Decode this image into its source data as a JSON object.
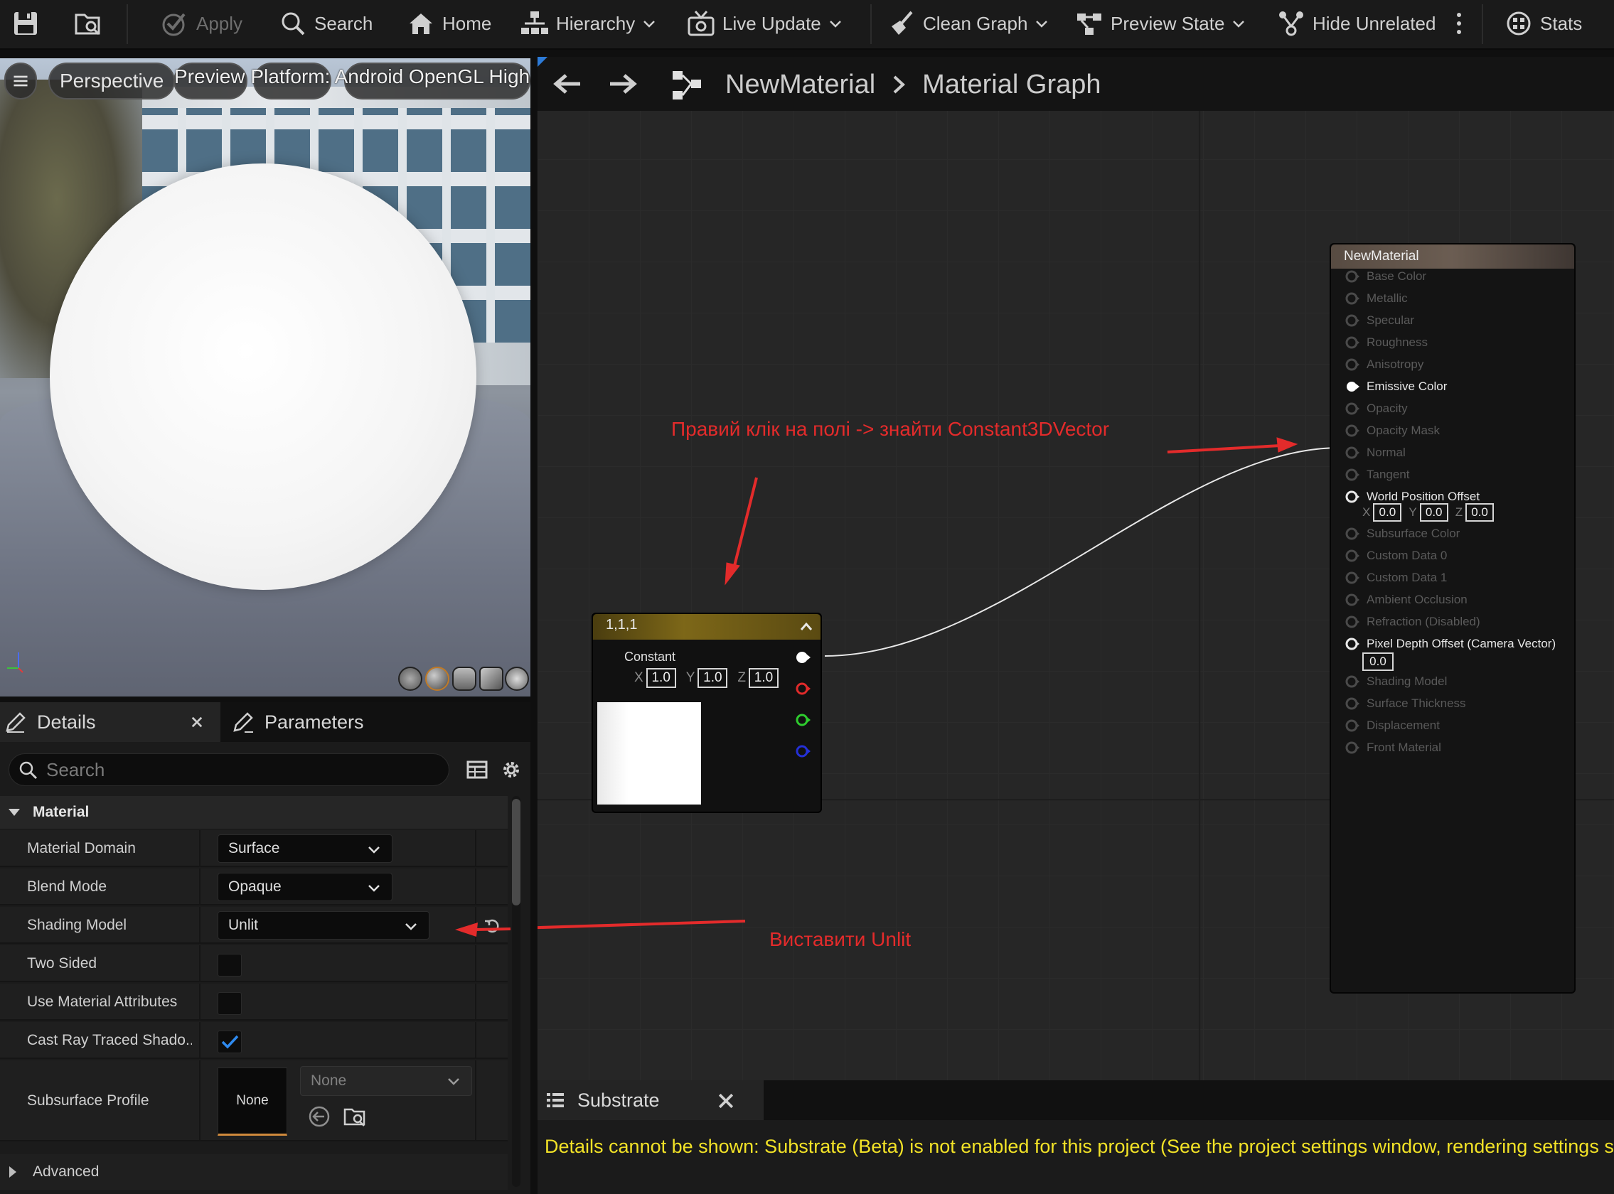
{
  "toolbar": {
    "apply": "Apply",
    "search": "Search",
    "home": "Home",
    "hierarchy": "Hierarchy",
    "live_update": "Live Update",
    "clean_graph": "Clean Graph",
    "preview_state": "Preview State",
    "hide_unrelated": "Hide Unrelated",
    "stats": "Stats"
  },
  "viewport": {
    "perspective": "Perspective",
    "overlay_text": "Preview Platform: Android OpenGL High"
  },
  "details": {
    "tab_details": "Details",
    "tab_parameters": "Parameters",
    "search_placeholder": "Search",
    "category": "Material",
    "properties": [
      {
        "label": "Material Domain",
        "value": "Surface"
      },
      {
        "label": "Blend Mode",
        "value": "Opaque"
      },
      {
        "label": "Shading Model",
        "value": "Unlit"
      },
      {
        "label": "Two Sided",
        "checked": false
      },
      {
        "label": "Use Material Attributes",
        "checked": false
      },
      {
        "label": "Cast Ray Traced Shado...",
        "checked": true
      },
      {
        "label": "Subsurface Profile",
        "thumb": "None",
        "value": "None"
      }
    ],
    "advanced": "Advanced"
  },
  "graph": {
    "breadcrumb": [
      "NewMaterial",
      "Material Graph"
    ],
    "constant_node": {
      "title": "1,1,1",
      "label": "Constant",
      "x": "1.0",
      "y": "1.0",
      "z": "1.0",
      "axis_x": "X",
      "axis_y": "Y",
      "axis_z": "Z",
      "preview_color": "#ffffff"
    },
    "result_node": {
      "title": "NewMaterial",
      "pins": [
        {
          "label": "Base Color",
          "active": false
        },
        {
          "label": "Metallic",
          "active": false
        },
        {
          "label": "Specular",
          "active": false
        },
        {
          "label": "Roughness",
          "active": false
        },
        {
          "label": "Anisotropy",
          "active": false
        },
        {
          "label": "Emissive Color",
          "active": true
        },
        {
          "label": "Opacity",
          "active": false
        },
        {
          "label": "Opacity Mask",
          "active": false
        },
        {
          "label": "Normal",
          "active": false
        },
        {
          "label": "Tangent",
          "active": false
        },
        {
          "label": "World Position Offset",
          "active": true
        },
        {
          "label": "Subsurface Color",
          "active": false
        },
        {
          "label": "Custom Data 0",
          "active": false
        },
        {
          "label": "Custom Data 1",
          "active": false
        },
        {
          "label": "Ambient Occlusion",
          "active": false
        },
        {
          "label": "Refraction (Disabled)",
          "active": false
        },
        {
          "label": "Pixel Depth Offset (Camera Vector)",
          "active": true
        },
        {
          "label": "Shading Model",
          "active": false
        },
        {
          "label": "Surface Thickness",
          "active": false
        },
        {
          "label": "Displacement",
          "active": false
        },
        {
          "label": "Front Material",
          "active": false
        }
      ],
      "wpo": {
        "x": "0.0",
        "y": "0.0",
        "z": "0.0"
      },
      "pdo": "0.0"
    },
    "annotations": {
      "find_node": "Правий клік на полі -> знайти Constant3DVector",
      "set_unlit": "Виставити Unlit"
    }
  },
  "substrate": {
    "tab": "Substrate",
    "message": "Details cannot be shown: Substrate (Beta) is not enabled for this project (See the project settings window, rendering settings s"
  },
  "colors": {
    "annotation": "#e32b2b",
    "message": "#f2e227",
    "accent": "#2d7bd8"
  }
}
